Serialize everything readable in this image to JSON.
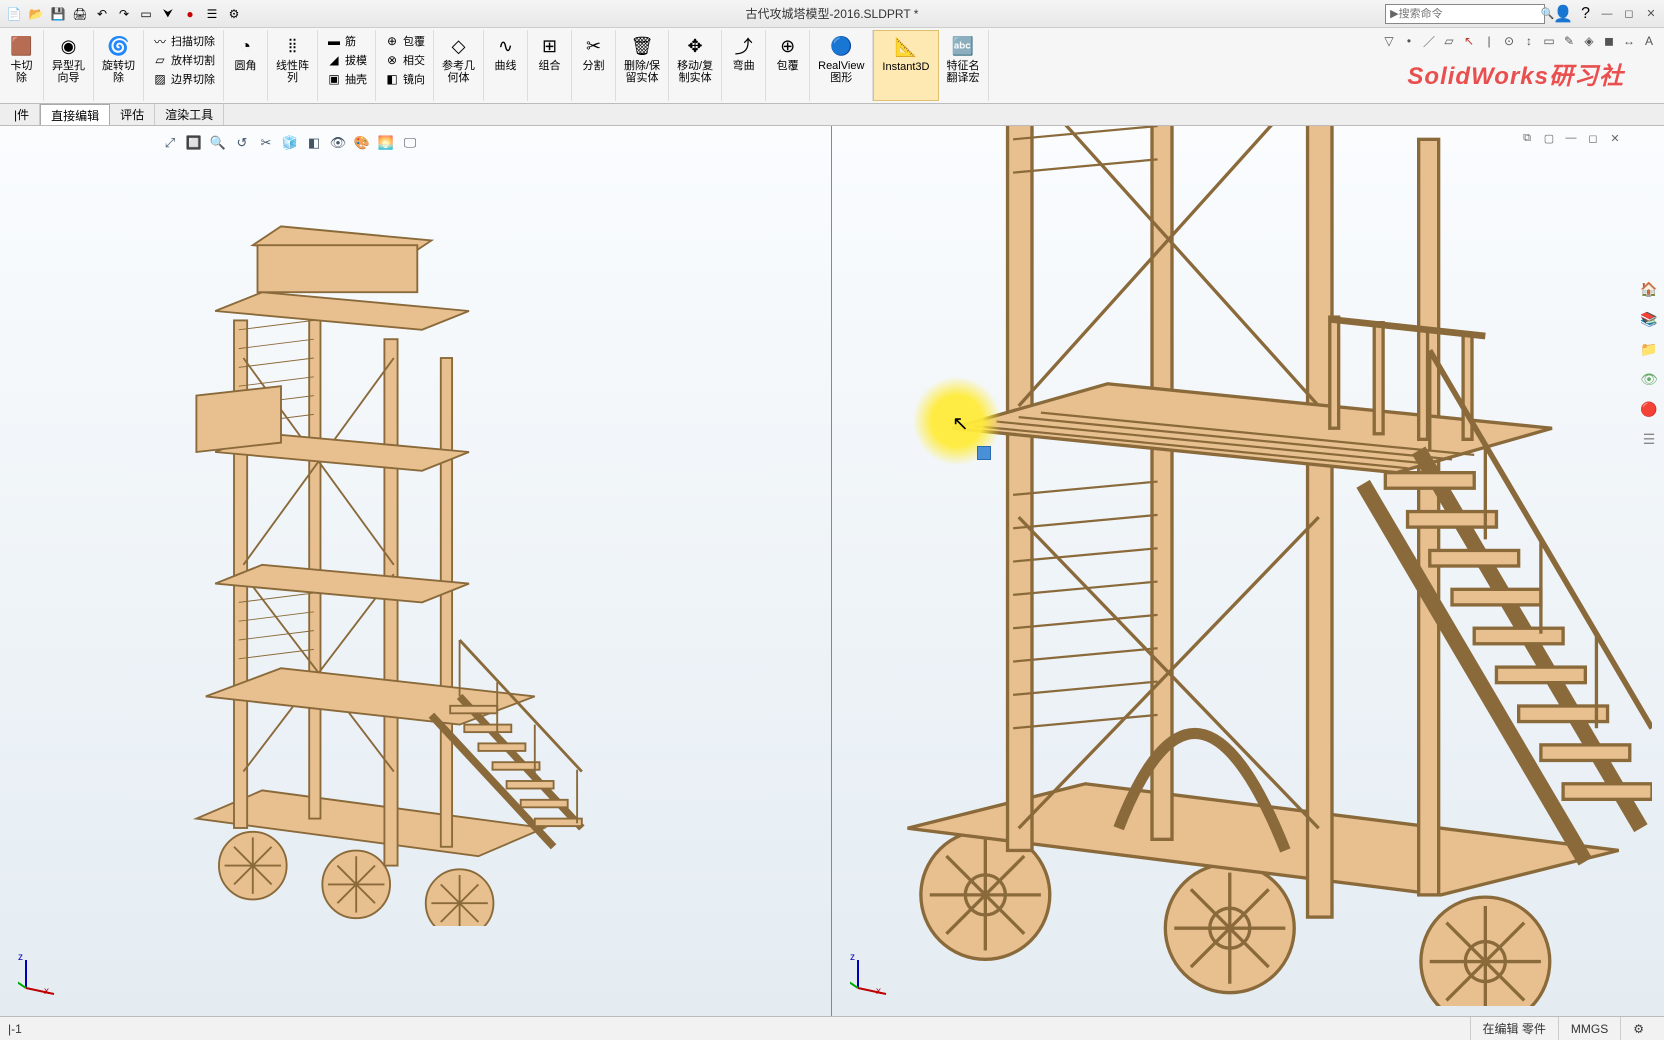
{
  "title_bar": {
    "document_title": "古代攻城塔模型-2016.SLDPRT *",
    "search_placeholder": "搜索命令"
  },
  "ribbon": {
    "groups": [
      {
        "type": "big",
        "label": "卡切\n除",
        "icon": "cube-cut"
      },
      {
        "type": "big",
        "label": "异型孔\n向导",
        "icon": "hole"
      },
      {
        "type": "big",
        "label": "旋转切\n除",
        "icon": "revolve-cut"
      },
      {
        "type": "small3",
        "items": [
          {
            "label": "扫描切除",
            "icon": "sweep-cut"
          },
          {
            "label": "放样切割",
            "icon": "loft-cut"
          },
          {
            "label": "边界切除",
            "icon": "boundary-cut"
          }
        ]
      },
      {
        "type": "big",
        "label": "圆角",
        "icon": "fillet"
      },
      {
        "type": "big",
        "label": "线性阵\n列",
        "icon": "linear-pattern"
      },
      {
        "type": "small3",
        "items": [
          {
            "label": "筋",
            "icon": "rib"
          },
          {
            "label": "拔模",
            "icon": "draft"
          },
          {
            "label": "抽壳",
            "icon": "shell"
          }
        ]
      },
      {
        "type": "small3",
        "items": [
          {
            "label": "包覆",
            "icon": "wrap"
          },
          {
            "label": "相交",
            "icon": "intersect"
          },
          {
            "label": "镜向",
            "icon": "mirror"
          }
        ]
      },
      {
        "type": "big",
        "label": "参考几\n何体",
        "icon": "ref-geom"
      },
      {
        "type": "big",
        "label": "曲线",
        "icon": "curve"
      },
      {
        "type": "big",
        "label": "组合",
        "icon": "combine"
      },
      {
        "type": "big",
        "label": "分割",
        "icon": "split"
      },
      {
        "type": "big",
        "label": "删除/保\n留实体",
        "icon": "delete-body"
      },
      {
        "type": "big",
        "label": "移动/复\n制实体",
        "icon": "move-body"
      },
      {
        "type": "big",
        "label": "弯曲",
        "icon": "flex"
      },
      {
        "type": "big",
        "label": "包覆",
        "icon": "wrap2"
      },
      {
        "type": "big",
        "label": "RealView\n图形",
        "icon": "realview"
      },
      {
        "type": "big",
        "label": "Instant3D",
        "icon": "instant3d",
        "active": true
      },
      {
        "type": "big",
        "label": "特征名\n翻译宏",
        "icon": "translate"
      }
    ]
  },
  "tabs": [
    {
      "label": "|件"
    },
    {
      "label": "直接编辑",
      "edge": true
    },
    {
      "label": "评估"
    },
    {
      "label": "渲染工具"
    }
  ],
  "watermark": "SolidWorks研习社",
  "status": {
    "left": "|-1",
    "edit_state": "在编辑 零件",
    "units": "MMGS"
  },
  "colors": {
    "wood_fill": "#e8c090",
    "wood_stroke": "#8a6a3a",
    "highlight": "#ffe766"
  }
}
